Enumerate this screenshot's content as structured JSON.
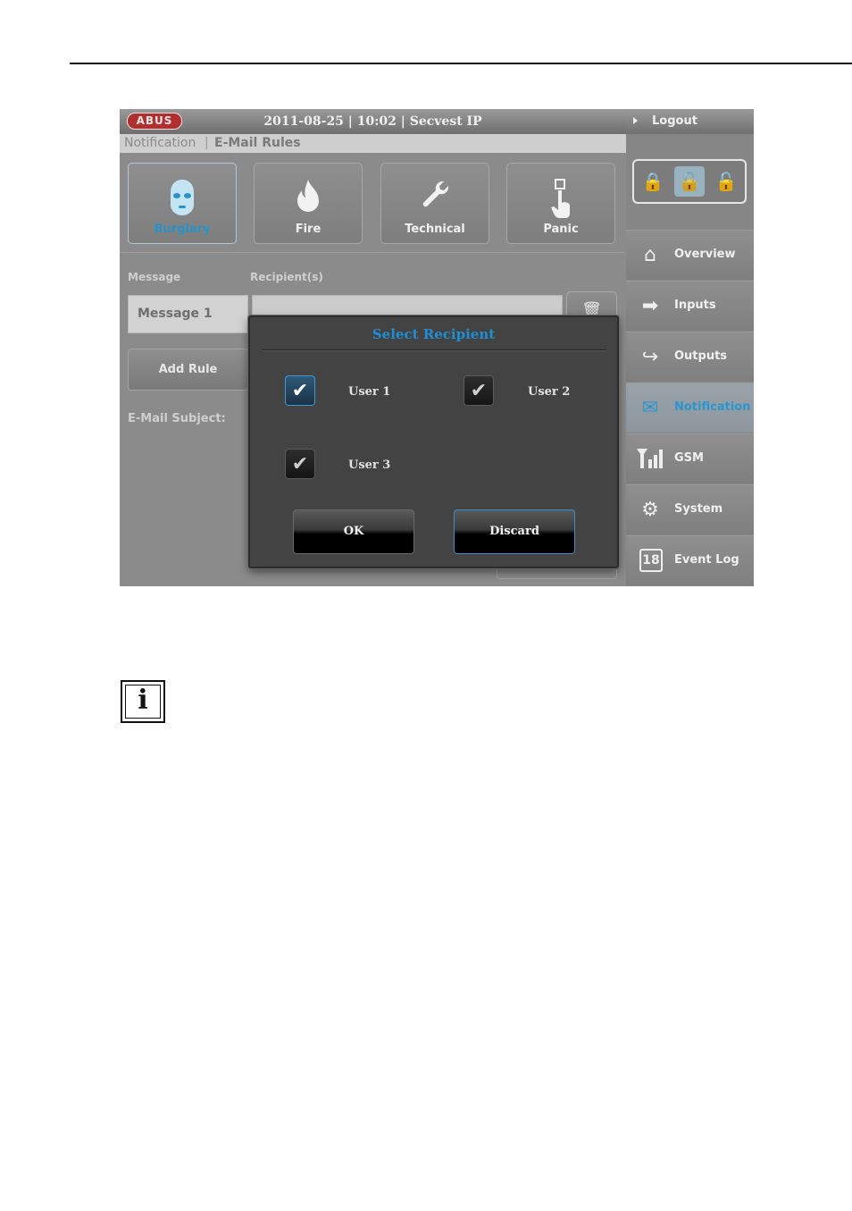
{
  "header": {
    "logo": "ABUS",
    "title": "2011-08-25  |  10:02  |  Secvest IP",
    "logout": "Logout"
  },
  "breadcrumb": {
    "section": "Notification",
    "separator": "|",
    "page": "E-Mail Rules"
  },
  "categories": [
    {
      "label": "Burglary",
      "icon": "mask-icon",
      "active": true
    },
    {
      "label": "Fire",
      "icon": "flame-icon"
    },
    {
      "label": "Technical",
      "icon": "wrench-icon"
    },
    {
      "label": "Panic",
      "icon": "panic-hand-icon"
    }
  ],
  "form": {
    "message_label": "Message",
    "recipients_label": "Recipient(s)",
    "message_value": "Message 1",
    "add_rule": "Add Rule",
    "email_subject_label": "E-Mail Subject:"
  },
  "sidebar": {
    "items": [
      {
        "label": "Overview",
        "icon": "home-icon"
      },
      {
        "label": "Inputs",
        "icon": "input-icon"
      },
      {
        "label": "Outputs",
        "icon": "output-icon"
      },
      {
        "label": "Notification",
        "icon": "envelope-icon",
        "active": true
      },
      {
        "label": "GSM",
        "icon": "signal-icon"
      },
      {
        "label": "System",
        "icon": "gears-icon"
      },
      {
        "label": "Event Log",
        "icon": "calendar-icon",
        "badge": "18"
      }
    ]
  },
  "modal": {
    "title": "Select Recipient",
    "users": [
      {
        "label": "User 1",
        "checked": true
      },
      {
        "label": "User 2",
        "checked": true
      },
      {
        "label": "User 3",
        "checked": true
      }
    ],
    "ok": "OK",
    "discard": "Discard"
  },
  "info_glyph": "i",
  "colors": {
    "accent": "#1f8ed6",
    "brand": "#b03030"
  }
}
